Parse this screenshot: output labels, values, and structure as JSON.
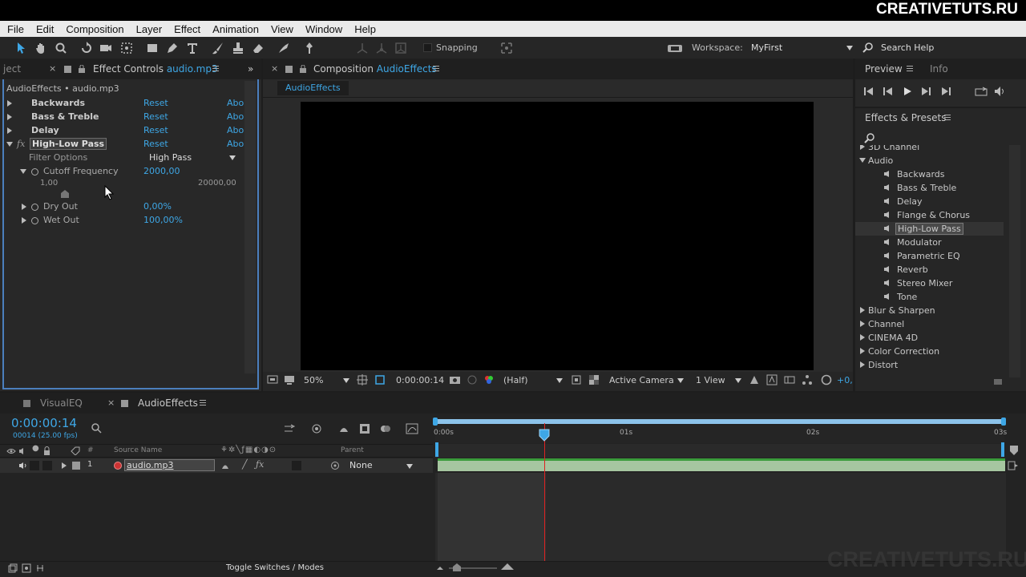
{
  "brand": "CREATIVETUTS.RU",
  "watermark": "CREATIVETUTS.RU",
  "menu": [
    "File",
    "Edit",
    "Composition",
    "Layer",
    "Effect",
    "Animation",
    "View",
    "Window",
    "Help"
  ],
  "toolbar": {
    "snapping": "Snapping",
    "workspace_label": "Workspace:",
    "workspace_value": "MyFirst",
    "search_help": "Search Help"
  },
  "effect_controls": {
    "left_tab_fragment": "ject",
    "tab_label": "Effect Controls",
    "tab_file": "audio.mp3",
    "breadcrumb": "AudioEffects • audio.mp3",
    "effects": [
      {
        "name": "Backwards",
        "reset": "Reset",
        "about": "Abo"
      },
      {
        "name": "Bass & Treble",
        "reset": "Reset",
        "about": "Abo"
      },
      {
        "name": "Delay",
        "reset": "Reset",
        "about": "Abo"
      },
      {
        "name": "High-Low Pass",
        "reset": "Reset",
        "about": "Abo"
      }
    ],
    "fx_label": "fx",
    "filter_options_label": "Filter Options",
    "filter_options_value": "High Pass",
    "cutoff_label": "Cutoff Frequency",
    "cutoff_value": "2000,00",
    "slider_min": "1,00",
    "slider_max": "20000,00",
    "dry_label": "Dry Out",
    "dry_value": "0,00%",
    "wet_label": "Wet Out",
    "wet_value": "100,00%"
  },
  "composition": {
    "tab_label": "Composition",
    "tab_name": "AudioEffects",
    "sub_tab": "AudioEffects",
    "zoom": "50%",
    "timecode": "0:00:00:14",
    "resolution": "(Half)",
    "camera": "Active Camera",
    "views": "1 View",
    "exposure": "+0,"
  },
  "preview": {
    "tab_preview": "Preview",
    "tab_info": "Info"
  },
  "effects_presets": {
    "title": "Effects & Presets",
    "search_placeholder": "",
    "partial_top": "3D Channel",
    "audio_category": "Audio",
    "audio_items": [
      "Backwards",
      "Bass & Treble",
      "Delay",
      "Flange & Chorus",
      "High-Low Pass",
      "Modulator",
      "Parametric EQ",
      "Reverb",
      "Stereo Mixer",
      "Tone"
    ],
    "categories_after": [
      "Blur & Sharpen",
      "Channel",
      "CINEMA 4D",
      "Color Correction",
      "Distort"
    ]
  },
  "timeline": {
    "tab_visualeq": "VisualEQ",
    "tab_audioeffects": "AudioEffects",
    "timecode": "0:00:00:14",
    "frames_fps": "00014 (25.00 fps)",
    "col_hash": "#",
    "col_source": "Source Name",
    "col_parent": "Parent",
    "layer_num": "1",
    "layer_name": "audio.mp3",
    "parent_value": "None",
    "ruler": [
      "0:00s",
      "01s",
      "02s",
      "03s"
    ],
    "toggle": "Toggle Switches / Modes"
  }
}
